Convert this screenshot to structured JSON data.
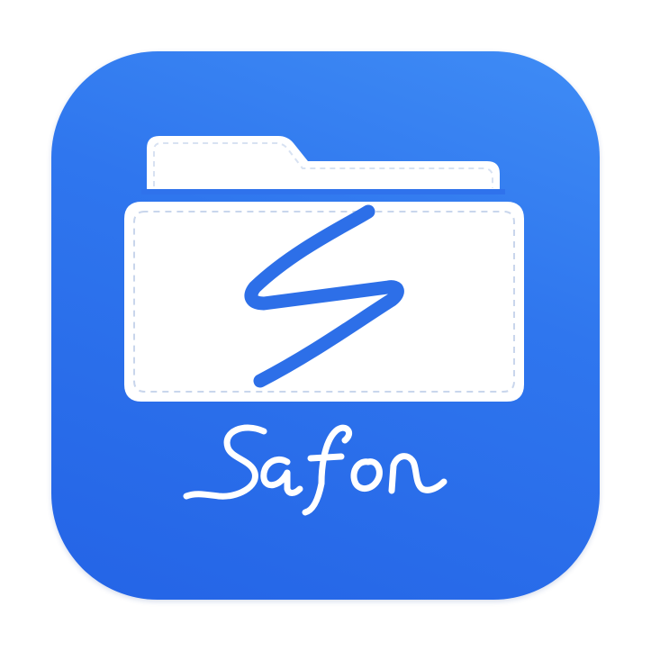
{
  "app": {
    "name": "Safon",
    "logo_letter": "S"
  },
  "colors": {
    "icon_gradient_start": "#3f8cf5",
    "icon_gradient_end": "#2464e6",
    "glyph_color": "#2d6fe8",
    "sketch_white": "#ffffff"
  },
  "icons": {
    "main": "folder-icon",
    "glyph": "s-letter-icon"
  }
}
